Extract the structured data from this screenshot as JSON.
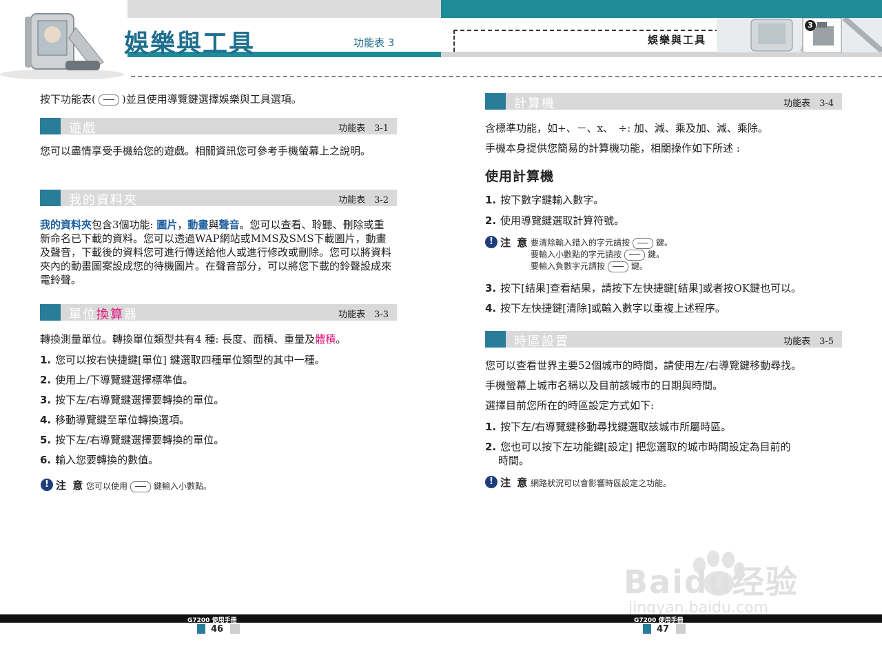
{
  "header": {
    "title": "娛樂與工具",
    "menu_ref_left": "功能表 3",
    "tab_label": "娛樂與工具",
    "tab_badge": "3"
  },
  "left": {
    "intro": {
      "before": "按下功能表(",
      "after": ")並且使用導覽鍵選擇娛樂與工具選項。"
    },
    "games": {
      "title": "遊戲",
      "num": "功能表　3-1",
      "body": "您可以盡情享受手機給您的遊戲。相關資訊您可參考手機螢幕上之說明。"
    },
    "folder": {
      "title": "我的資料夾",
      "num": "功能表　3-2",
      "p1_a": "我的資料夾",
      "p1_b": "包含3個功能: ",
      "p1_c": "圖片",
      "p1_d": "，",
      "p1_e": "動畫",
      "p1_f": "與",
      "p1_g": "聲音",
      "p1_h": "。您可以查看、聆聽、刪除或重新命名已下載的資料。您可以透過WAP網站或MMS及SMS下載圖片，動畫及聲音，下載後的資料您可進行傳送給他人或進行修改或刪除。您可以將資料夾內的動畫圖案設成您的待機圖片。在聲音部分，可以將您下載的鈴聲設成來電鈴聲。"
    },
    "converter": {
      "title_a": "單位",
      "title_b": "換算",
      "title_c": "器",
      "num": "功能表　3-3",
      "intro_a": "轉換測量單位。轉換單位類型共有4 種: 長度、面積、重量及",
      "intro_b": "體積",
      "intro_c": "。",
      "steps": [
        {
          "n": "1.",
          "t": "您可以按右快捷鍵[單位] 鍵選取四種單位類型的其中一種。"
        },
        {
          "n": "2.",
          "t": "使用上/下導覽鍵選擇標準值。"
        },
        {
          "n": "3.",
          "t": "按下左/右導覽鍵選擇要轉換的單位。"
        },
        {
          "n": "4.",
          "t": "移動導覽鍵至單位轉換選項。"
        },
        {
          "n": "5.",
          "t": "按下左/右導覽鍵選擇要轉換的單位。"
        },
        {
          "n": "6.",
          "t": "輸入您要轉換的數值。"
        }
      ],
      "note_label": "注 意",
      "note_a": "您可以使用",
      "note_b": "鍵輸入小數點。"
    }
  },
  "right": {
    "calc": {
      "title": "計算機",
      "num": "功能表　3-4",
      "p1": "含標準功能，如+、－、x、　÷: 加、減、乘及加、減、乘除。",
      "p2": "手機本身提供您簡易的計算機功能，相關操作如下所述 :",
      "subhead": "使用計算機",
      "steps_a": [
        {
          "n": "1.",
          "t": "按下數字鍵輸入數字。"
        },
        {
          "n": "2.",
          "t": "使用導覽鍵選取計算符號。"
        }
      ],
      "note_label": "注 意",
      "note_lines": [
        {
          "a": "要清除輸入錯入的字元請按",
          "b": "鍵。"
        },
        {
          "a": "要輸入小數點的字元請按",
          "b": "鍵。"
        },
        {
          "a": "要輸入負數字元請按",
          "b": "鍵。"
        }
      ],
      "steps_b": [
        {
          "n": "3.",
          "t": "按下[結果]查看結果，請按下左快捷鍵[結果]或者按OK鍵也可以。"
        },
        {
          "n": "4.",
          "t": "按下左快捷鍵[清除]或輸入數字以重複上述程序。"
        }
      ]
    },
    "timezone": {
      "title": "時區設置",
      "num": "功能表　3-5",
      "p1": "您可以查看世界主要52個城市的時間，請使用左/右導覽鍵移動尋找。",
      "p2": "手機螢幕上城市名稱以及目前該城市的日期與時間。",
      "p3": "選擇目前您所在的時區設定方式如下:",
      "step1": {
        "n": "1.",
        "t": "按下左/右導覽鍵移動尋找鍵選取該城市所屬時區。"
      },
      "step2": {
        "n": "2.",
        "t1": "您也可以按下左功能鍵[設定] 把您選取的城市時間設定為目前的",
        "t2": "時間。"
      },
      "note_label": "注 意",
      "note": "網路狀況可以會影響時區設定之功能。"
    }
  },
  "footer": {
    "left_label": "G7200 使用手冊",
    "left_page": "46",
    "right_label": "G7200 使用手冊",
    "right_page": "47"
  },
  "watermark": {
    "brand_a": "Bai",
    "brand_b": "du",
    "brand_c": "经验",
    "url": "jingyan.baidu.com"
  },
  "colors": {
    "teal": "#2a7d99",
    "pink": "#e0157e",
    "blue": "#1f5fa0",
    "gray_bar": "#d9d9d9"
  }
}
